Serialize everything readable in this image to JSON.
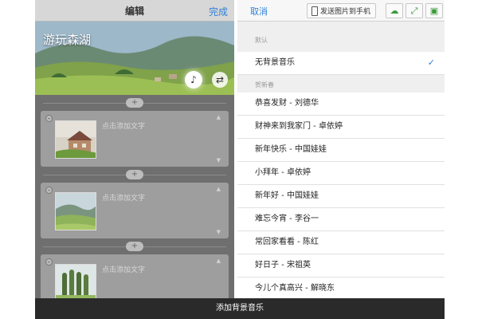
{
  "editor": {
    "title": "编辑",
    "done_label": "完成",
    "cover_title": "游玩森湖",
    "music_icon": "music-note-icon",
    "swap_icon": "swap-icon",
    "cards": [
      {
        "text_placeholder": "点击添加文字"
      },
      {
        "text_placeholder": "点击添加文字"
      },
      {
        "text_placeholder": "点击添加文字"
      }
    ]
  },
  "music_panel": {
    "cancel_label": "取消",
    "send_label": "发送图片到手机",
    "default_section": "默认",
    "default_items": [
      {
        "title": "无背景音乐",
        "selected": true
      }
    ],
    "newyear_section": "贺新春",
    "newyear_items": [
      {
        "title": "恭喜发财 - 刘德华"
      },
      {
        "title": "财神来到我家门 - 卓依婷"
      },
      {
        "title": "新年快乐 - 中国娃娃"
      },
      {
        "title": "小拜年 - 卓依婷"
      },
      {
        "title": "新年好 - 中国娃娃"
      },
      {
        "title": "难忘今宵 - 李谷一"
      },
      {
        "title": "常回家看看 - 陈红"
      },
      {
        "title": "好日子 - 宋祖英"
      },
      {
        "title": "今儿个真高兴 - 解晓东"
      }
    ]
  },
  "bottom_bar": {
    "label": "添加背景音乐"
  },
  "colors": {
    "accent": "#2f80d8",
    "bottom_bar": "#2a2a2a",
    "tool_green": "#3a9a3a"
  }
}
